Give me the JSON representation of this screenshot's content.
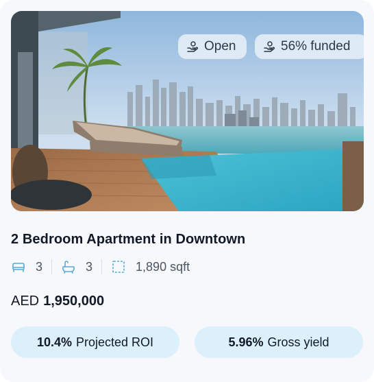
{
  "listing": {
    "status_label": "Open",
    "funded_label": "56% funded",
    "title": "2 Bedroom Apartment in Downtown",
    "bedrooms": "3",
    "bathrooms": "3",
    "area": "1,890 sqft",
    "price_currency": "AED",
    "price_amount": "1,950,000",
    "roi_value": "10.4%",
    "roi_label": "Projected ROI",
    "yield_value": "5.96%",
    "yield_label": "Gross yield"
  },
  "icons": {
    "status": "hand-coins-icon",
    "funded": "hand-coins-icon",
    "bedrooms": "bed-icon",
    "bathrooms": "bathtub-icon",
    "area": "area-icon"
  },
  "colors": {
    "card_bg": "#f6f8fb",
    "metric_bg": "#dcf0fb",
    "icon_accent": "#5aa9d6",
    "text_dark": "#111827"
  }
}
